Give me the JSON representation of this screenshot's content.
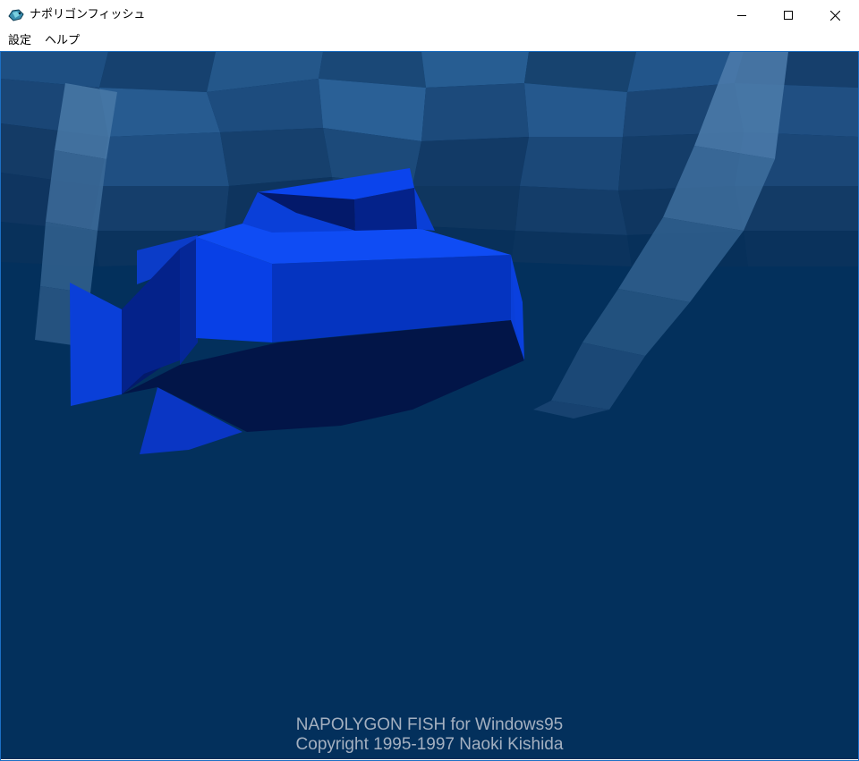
{
  "window": {
    "title": "ナポリゴンフィッシュ",
    "app_icon": "fish-app-icon",
    "controls": {
      "minimize": "minimize-icon",
      "maximize": "maximize-icon",
      "close": "close-icon"
    }
  },
  "menu": {
    "items": [
      {
        "label": "設定"
      },
      {
        "label": "ヘルプ"
      }
    ]
  },
  "scene": {
    "water_color": "#03305c",
    "fish_color": "#0a3fe0",
    "credits": {
      "line1": "NAPOLYGON FISH for Windows95",
      "line2": "Copyright 1995-1997 Naoki Kishida"
    }
  }
}
